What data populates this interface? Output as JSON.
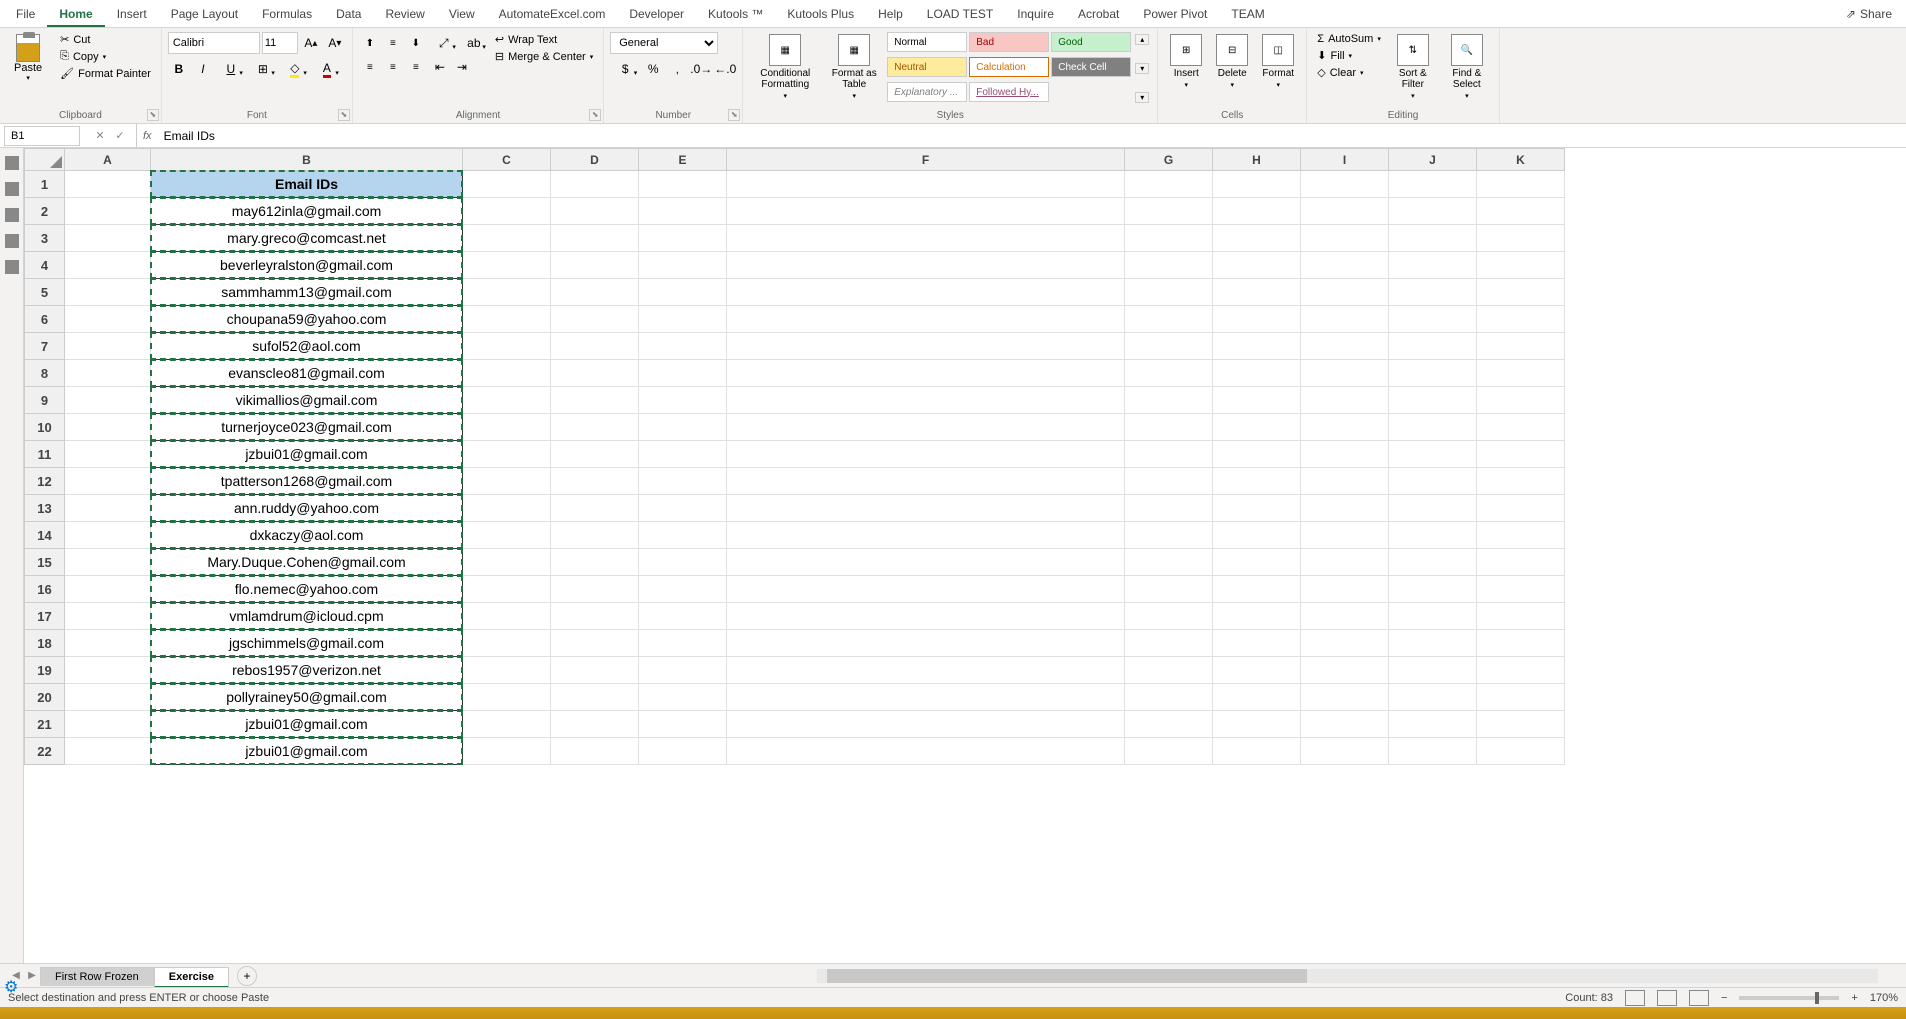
{
  "ribbon_tabs": [
    "File",
    "Home",
    "Insert",
    "Page Layout",
    "Formulas",
    "Data",
    "Review",
    "View",
    "AutomateExcel.com",
    "Developer",
    "Kutools ™",
    "Kutools Plus",
    "Help",
    "LOAD TEST",
    "Inquire",
    "Acrobat",
    "Power Pivot",
    "TEAM"
  ],
  "active_tab": "Home",
  "share_label": "Share",
  "clipboard": {
    "paste": "Paste",
    "cut": "Cut",
    "copy": "Copy",
    "format_painter": "Format Painter",
    "label": "Clipboard"
  },
  "font": {
    "name": "Calibri",
    "size": "11",
    "label": "Font"
  },
  "alignment": {
    "wrap": "Wrap Text",
    "merge": "Merge & Center",
    "label": "Alignment"
  },
  "number": {
    "format": "General",
    "label": "Number"
  },
  "styles": {
    "cond": "Conditional Formatting",
    "table": "Format as Table",
    "gallery": [
      {
        "label": "Normal",
        "bg": "#fff",
        "color": "#000"
      },
      {
        "label": "Bad",
        "bg": "#f8c7c4",
        "color": "#9c0006"
      },
      {
        "label": "Good",
        "bg": "#c6efce",
        "color": "#006100"
      },
      {
        "label": "Neutral",
        "bg": "#ffeb9c",
        "color": "#9c5700"
      },
      {
        "label": "Calculation",
        "bg": "#fff",
        "color": "#d66b00",
        "border": "#d66b00"
      },
      {
        "label": "Check Cell",
        "bg": "#808080",
        "color": "#fff"
      },
      {
        "label": "Explanatory ...",
        "bg": "#fff",
        "color": "#7f7f7f",
        "italic": true
      },
      {
        "label": "Followed Hy...",
        "bg": "#fff",
        "color": "#954f72",
        "underline": true
      }
    ],
    "label": "Styles"
  },
  "cells": {
    "insert": "Insert",
    "delete": "Delete",
    "format": "Format",
    "label": "Cells"
  },
  "editing": {
    "autosum": "AutoSum",
    "fill": "Fill",
    "clear": "Clear",
    "sort": "Sort & Filter",
    "find": "Find & Select",
    "label": "Editing"
  },
  "name_box": "B1",
  "formula_value": "Email IDs",
  "columns": [
    "A",
    "B",
    "C",
    "D",
    "E",
    "F",
    "G",
    "H",
    "I",
    "J",
    "K"
  ],
  "row_count": 22,
  "header_text": "Email IDs",
  "emails": [
    "may612inla@gmail.com",
    "mary.greco@comcast.net",
    "beverleyralston@gmail.com",
    "sammhamm13@gmail.com",
    "choupana59@yahoo.com",
    "sufol52@aol.com",
    "evanscleo81@gmail.com",
    "vikimallios@gmail.com",
    "turnerjoyce023@gmail.com",
    "jzbui01@gmail.com",
    "tpatterson1268@gmail.com",
    "ann.ruddy@yahoo.com",
    "dxkaczy@aol.com",
    "Mary.Duque.Cohen@gmail.com",
    "flo.nemec@yahoo.com",
    "vmlamdrum@icloud.cpm",
    "jgschimmels@gmail.com",
    "rebos1957@verizon.net",
    "pollyrainey50@gmail.com",
    "jzbui01@gmail.com",
    "jzbui01@gmail.com"
  ],
  "sheet_tabs": [
    "First Row Frozen",
    "Exercise"
  ],
  "active_sheet": "Exercise",
  "status_text": "Select destination and press ENTER or choose Paste",
  "status_count": "Count: 83",
  "zoom": "170%"
}
